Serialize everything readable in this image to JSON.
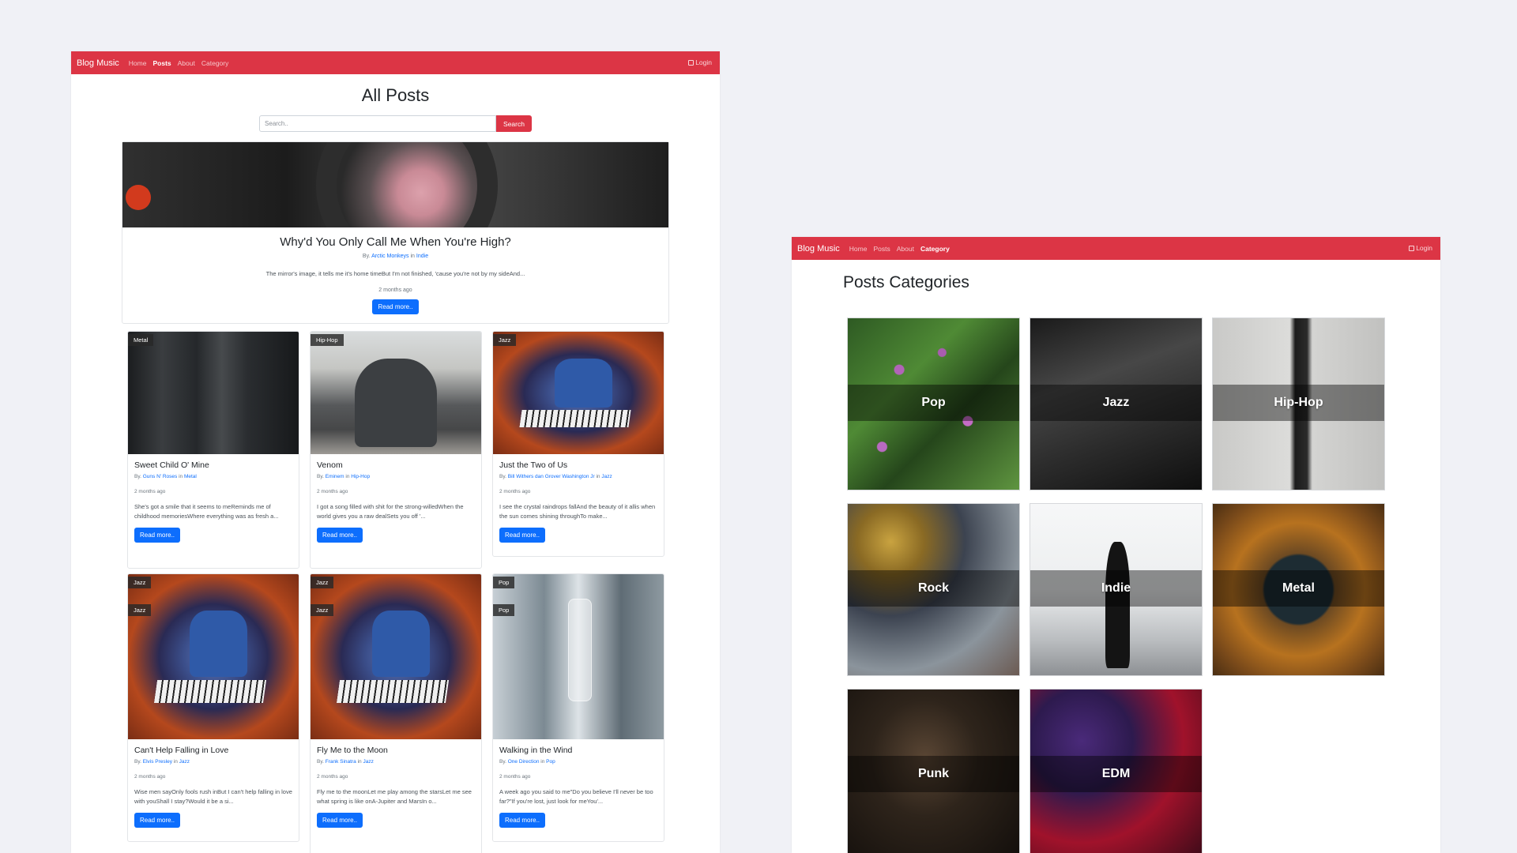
{
  "posts_window": {
    "navbar": {
      "brand": "Blog Music",
      "links": [
        "Home",
        "Posts",
        "About",
        "Category"
      ],
      "active": "Posts",
      "login": "Login"
    },
    "page_title": "All Posts",
    "search": {
      "placeholder": "Search..",
      "button": "Search"
    },
    "featured": {
      "title": "Why'd You Only Call Me When You're High?",
      "by_prefix": "By.",
      "artist": "Arctic Monkeys",
      "in_word": "in",
      "category": "Indie",
      "excerpt": "The mirror's image, it tells me it's home timeBut I'm not finished, 'cause you're not by my sideAnd...",
      "time": "2 months ago",
      "button": "Read more.."
    },
    "cards": [
      {
        "badge": "Metal",
        "title": "Sweet Child O' Mine",
        "artist": "Guns N' Roses",
        "category": "Metal",
        "time": "2 months ago",
        "excerpt": "She's got a smile that it seems to meReminds me of childhood memoriesWhere everything was as fresh a...",
        "button": "Read more.."
      },
      {
        "badge": "Hip-Hop",
        "title": "Venom",
        "artist": "Eminem",
        "category": "Hip-Hop",
        "time": "2 months ago",
        "excerpt": "I got a song filled with shit for the strong-willedWhen the world gives you a raw dealSets you off '...",
        "button": "Read more.."
      },
      {
        "badge": "Jazz",
        "title": "Just the Two of Us",
        "artist": "Bill Withers dan Grover Washington Jr",
        "category": "Jazz",
        "time": "2 months ago",
        "excerpt": "I see the crystal raindrops fallAnd the beauty of it allis when the sun comes shining throughTo make...",
        "button": "Read more.."
      },
      {
        "badge": "Jazz",
        "title": "Can't Help Falling in Love",
        "artist": "Elvis Presley",
        "category": "Jazz",
        "time": "2 months ago",
        "excerpt": "Wise men sayOnly fools rush inBut I can't help falling in love with youShall I stay?Would it be a si...",
        "button": "Read more.."
      },
      {
        "badge": "Jazz",
        "title": "Fly Me to the Moon",
        "artist": "Frank Sinatra",
        "category": "Jazz",
        "time": "2 months ago",
        "excerpt": "Fly me to the moonLet me play among the starsLet me see what spring is like onA-Jupiter and MarsIn o...",
        "button": "Read more.."
      },
      {
        "badge": "Pop",
        "title": "Walking in the Wind",
        "artist": "One Direction",
        "category": "Pop",
        "time": "2 months ago",
        "excerpt": "A week ago you said to me\"Do you believe I'll never be too far?\"If you're lost, just look for meYou'...",
        "button": "Read more.."
      }
    ],
    "by_prefix": "By.",
    "in_word": "in"
  },
  "categories_window": {
    "navbar": {
      "brand": "Blog Music",
      "links": [
        "Home",
        "Posts",
        "About",
        "Category"
      ],
      "active": "Category",
      "login": "Login"
    },
    "title": "Posts Categories",
    "categories": [
      "Pop",
      "Jazz",
      "Hip-Hop",
      "Rock",
      "Indie",
      "Metal",
      "Punk",
      "EDM"
    ]
  },
  "colors": {
    "navbar": "#dc3545",
    "primary_button": "#0d6efd",
    "background": "#f0f1f6"
  }
}
